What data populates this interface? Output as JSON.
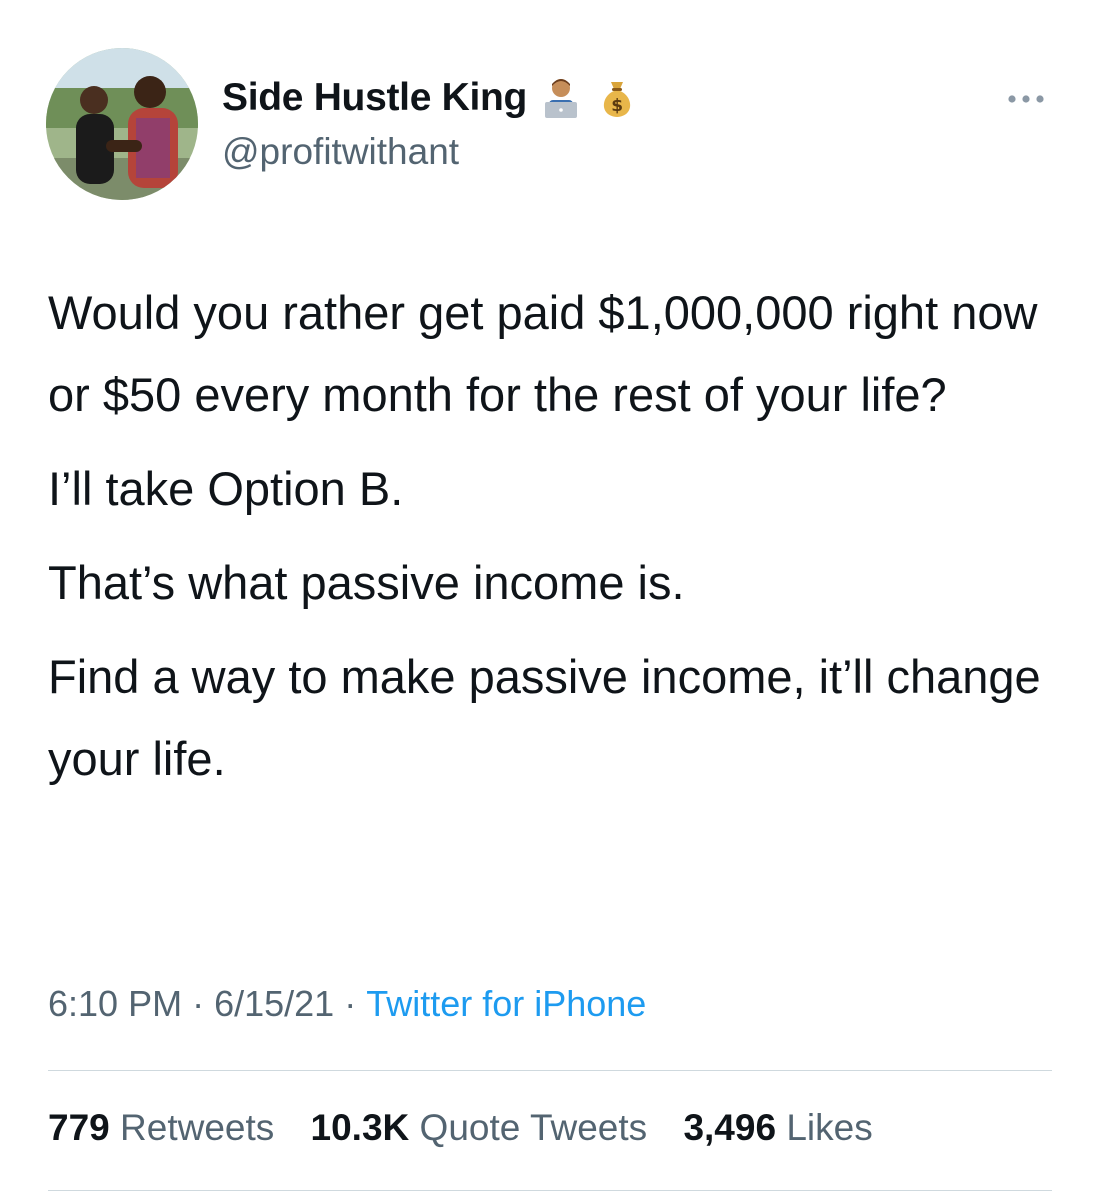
{
  "author": {
    "name": "Side Hustle King",
    "handle": "@profitwithant",
    "name_emojis": [
      "technologist-emoji",
      "money-bag-emoji"
    ]
  },
  "header": {
    "more_icon": "ellipsis-icon"
  },
  "tweet": {
    "paragraphs": [
      "Would you rather get paid $1,000,000 right now or $50 every month for the rest of your life?",
      "I’ll take Option B.",
      "That’s what passive income is.",
      "Find a way to make passive income, it’ll change your life."
    ]
  },
  "meta": {
    "time": "6:10 PM",
    "date": "6/15/21",
    "separator": "·",
    "source": "Twitter for iPhone"
  },
  "stats": {
    "retweets_count": "779",
    "retweets_label": "Retweets",
    "quotes_count": "10.3K",
    "quotes_label": "Quote Tweets",
    "likes_count": "3,496",
    "likes_label": "Likes"
  },
  "colors": {
    "text": "#0f1419",
    "secondary": "#536471",
    "link": "#1d9bf0",
    "divider": "#cfd9de"
  }
}
